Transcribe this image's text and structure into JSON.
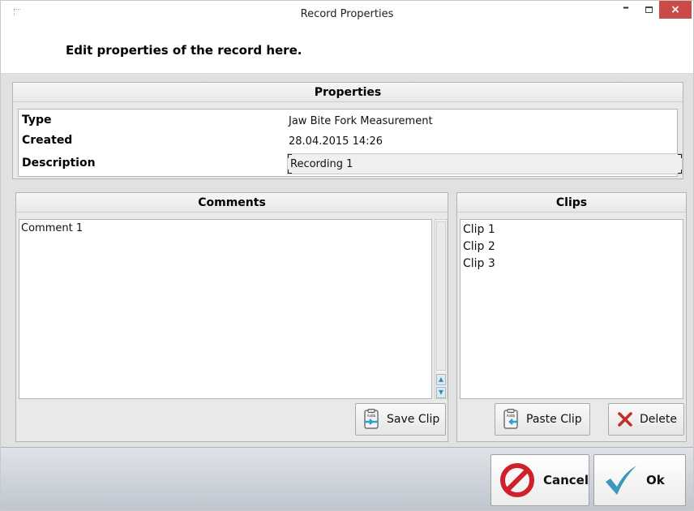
{
  "window": {
    "title": "Record Properties",
    "minimize_label": "–",
    "close_label": "×"
  },
  "header": {
    "text": "Edit properties of the record here."
  },
  "properties": {
    "title": "Properties",
    "rows": [
      {
        "label": "Type",
        "value": "Jaw Bite Fork Measurement"
      },
      {
        "label": "Created",
        "value": "28.04.2015 14:26"
      },
      {
        "label": "Description",
        "value": "Recording 1"
      }
    ]
  },
  "comments": {
    "title": "Comments",
    "text": "Comment 1",
    "save_clip_label": "Save Clip",
    "scroll_up_glyph": "▲",
    "scroll_down_glyph": "▼"
  },
  "clips": {
    "title": "Clips",
    "items": [
      "Clip 1",
      "Clip 2",
      "Clip 3"
    ],
    "paste_clip_label": "Paste Clip",
    "delete_label": "Delete"
  },
  "footer": {
    "cancel_label": "Cancel",
    "ok_label": "Ok"
  },
  "icons": {
    "app": "app-icon",
    "clipboard": "clipboard-icon",
    "delete": "delete-x-icon",
    "cancel": "no-entry-icon",
    "ok": "checkmark-icon"
  },
  "colors": {
    "close_button": "#c94a47",
    "delete_icon": "#c0302a",
    "cancel_icon": "#d0202a",
    "ok_icon": "#3c97bd",
    "clipboard_arrow": "#2f9fd0"
  }
}
